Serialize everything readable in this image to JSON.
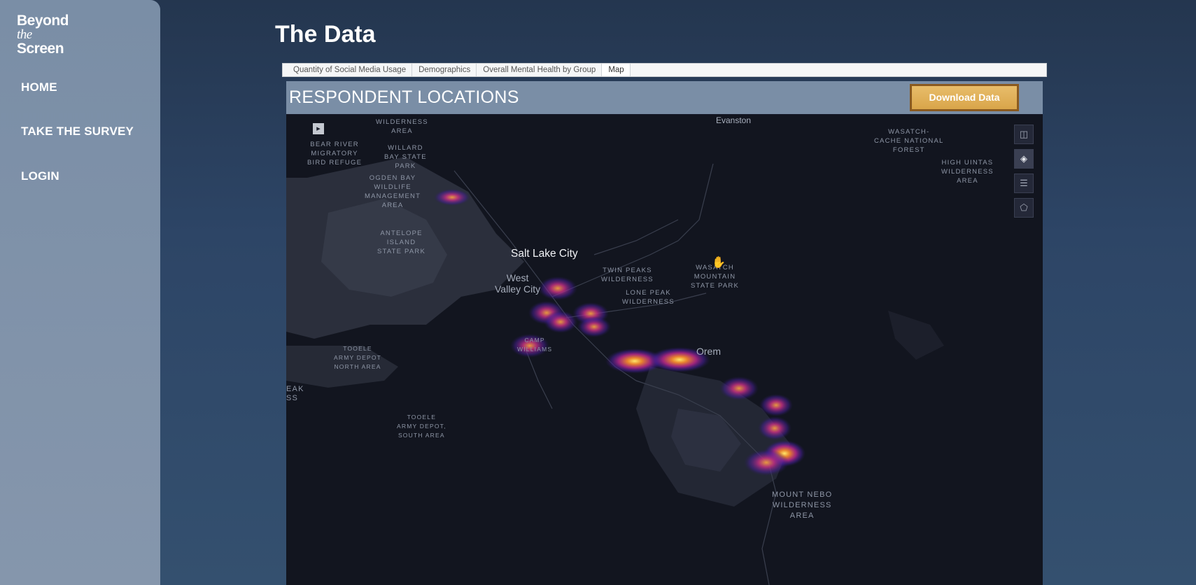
{
  "sidebar": {
    "logo": {
      "line1": "Beyond",
      "line2": "the",
      "line3": "Screen"
    },
    "nav": [
      {
        "label": "HOME"
      },
      {
        "label": "TAKE THE SURVEY"
      },
      {
        "label": "LOGIN"
      }
    ]
  },
  "page": {
    "title": "The Data"
  },
  "tabs": [
    {
      "label": "Quantity of Social Media Usage"
    },
    {
      "label": "Demographics"
    },
    {
      "label": "Overall Mental Health by Group"
    },
    {
      "label": "Map"
    }
  ],
  "dashboard": {
    "title": "RESPONDENT LOCATIONS",
    "download_label": "Download Data"
  },
  "map": {
    "labels": {
      "wilderness_area": "WILDERNESS\nAREA",
      "evanston": "Evanston",
      "bear_river": "BEAR RIVER\nMIGRATORY\nBIRD REFUGE",
      "willard": "WILLARD\nBAY STATE\nPARK",
      "wasatch_cache": "WASATCH-\nCACHE NATIONAL\nFOREST",
      "high_uintas": "HIGH UINTAS\nWILDERNESS\nAREA",
      "ogden_bay": "OGDEN BAY\nWILDLIFE\nMANAGEMENT\nAREA",
      "antelope": "ANTELOPE\nISLAND\nSTATE PARK",
      "salt_lake_city": "Salt Lake City",
      "west_valley": "West\nValley City",
      "twin_peaks": "TWIN PEAKS\nWILDERNESS",
      "wasatch_mountain": "WASATCH\nMOUNTAIN\nSTATE PARK",
      "lone_peak": "LONE PEAK\nWILDERNESS",
      "camp_williams": "CAMP\nWILLIAMS",
      "tooele_north": "TOOELE\nARMY DEPOT\nNORTH AREA",
      "orem": "Orem",
      "peak_edge": "EAK\nSS",
      "tooele_south": "TOOELE\nARMY DEPOT,\nSOUTH AREA",
      "mount_nebo": "MOUNT NEBO\nWILDERNESS\nAREA"
    },
    "icons": [
      "expand-icon",
      "columns-icon",
      "globe-icon",
      "list-icon",
      "polygon-select-icon",
      "hand-cursor-icon"
    ],
    "heatmap_colors": {
      "outer": "#3a1a8a",
      "mid": "#b02a8a",
      "inner": "#f07a30",
      "core": "#ffd84a"
    }
  }
}
